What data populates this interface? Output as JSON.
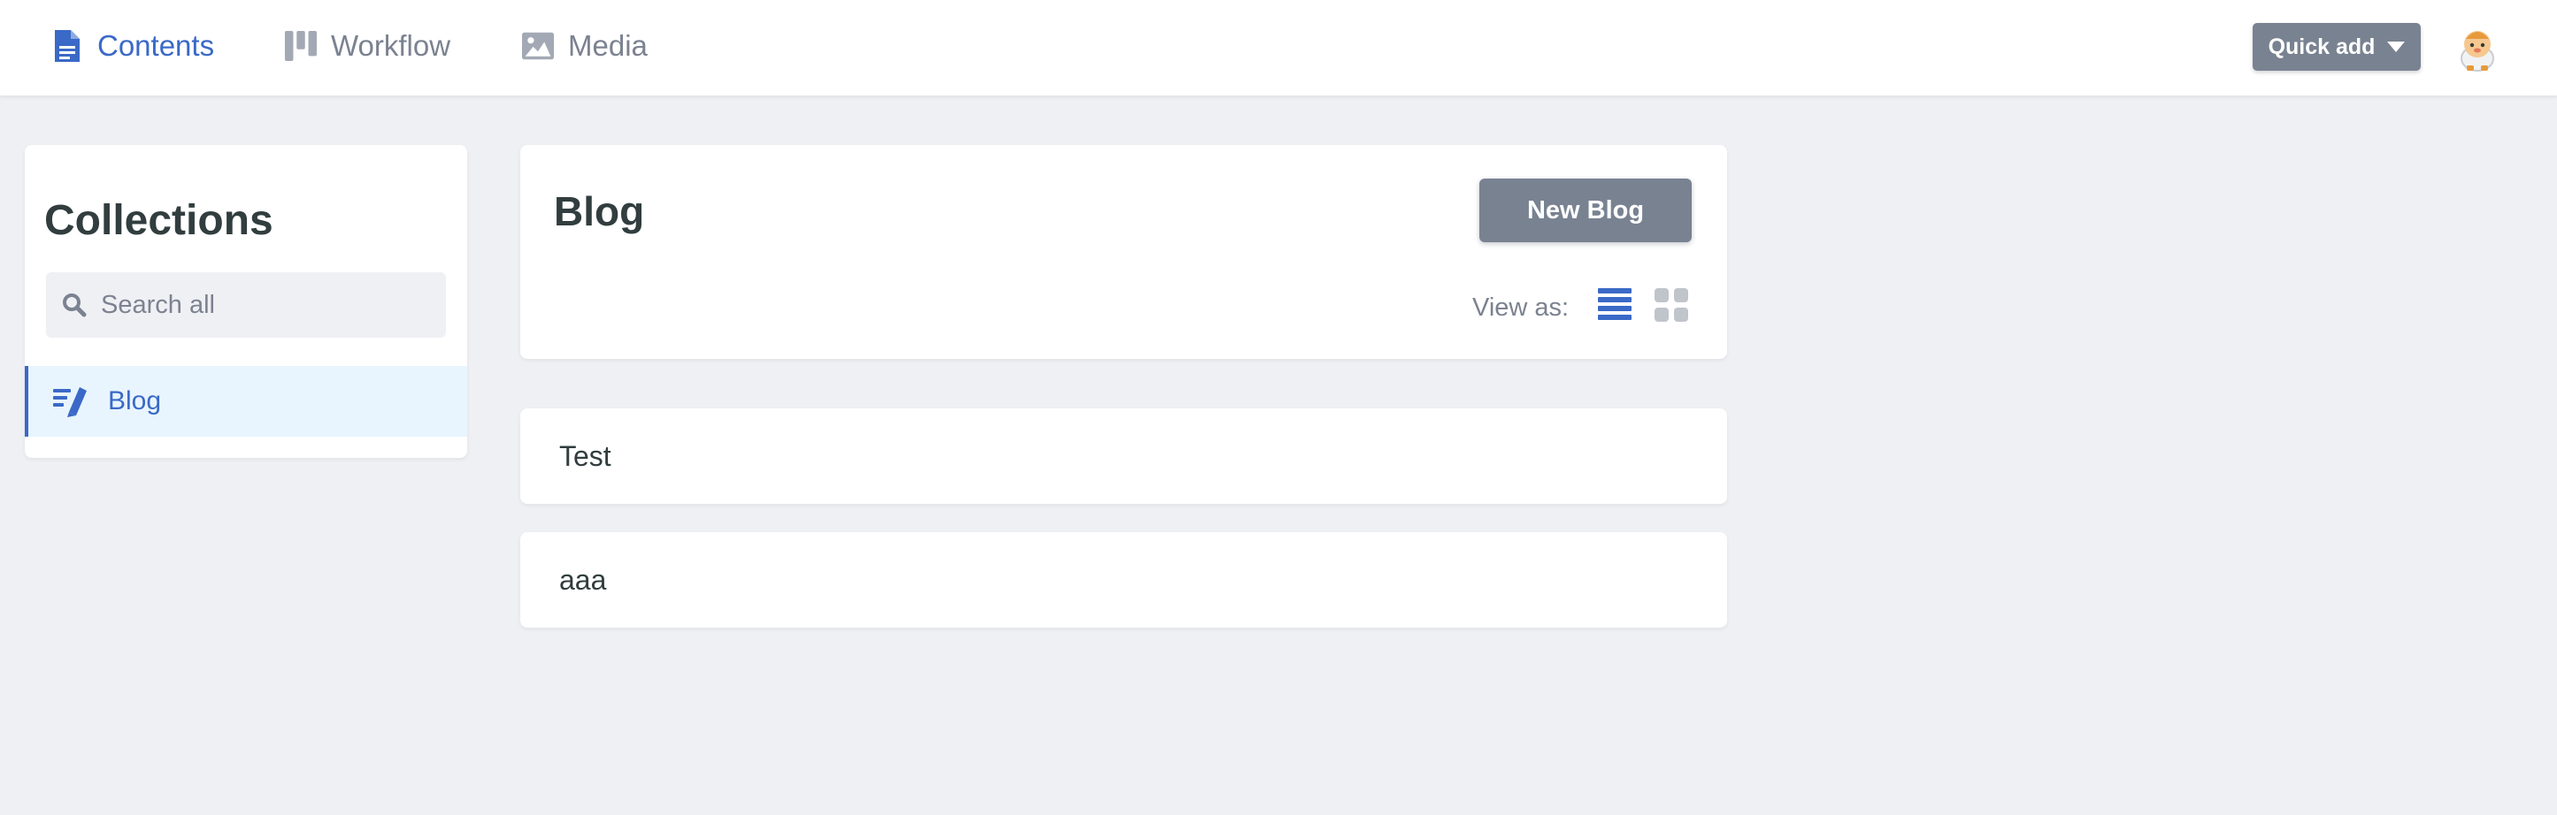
{
  "nav": {
    "items": [
      {
        "label": "Contents",
        "icon": "document-icon",
        "active": true
      },
      {
        "label": "Workflow",
        "icon": "kanban-icon",
        "active": false
      },
      {
        "label": "Media",
        "icon": "image-icon",
        "active": false
      }
    ]
  },
  "header": {
    "quick_add_label": "Quick add",
    "avatar_icon": "avatar-icon"
  },
  "sidebar": {
    "title": "Collections",
    "search_placeholder": "Search all",
    "search_value": "",
    "collections": [
      {
        "label": "Blog",
        "icon": "write-icon",
        "active": true
      }
    ]
  },
  "main": {
    "title": "Blog",
    "new_button_label": "New Blog",
    "view_as_label": "View as:",
    "view_modes": [
      "list",
      "grid"
    ],
    "active_view": "list",
    "entries": [
      {
        "title": "Test"
      },
      {
        "title": "aaa"
      }
    ]
  },
  "colors": {
    "accent": "#3a69c7",
    "background": "#eff0f4",
    "button": "#798291",
    "text": "#313d3e",
    "muted": "#7b8290",
    "active_bg": "#e8f5fe"
  }
}
